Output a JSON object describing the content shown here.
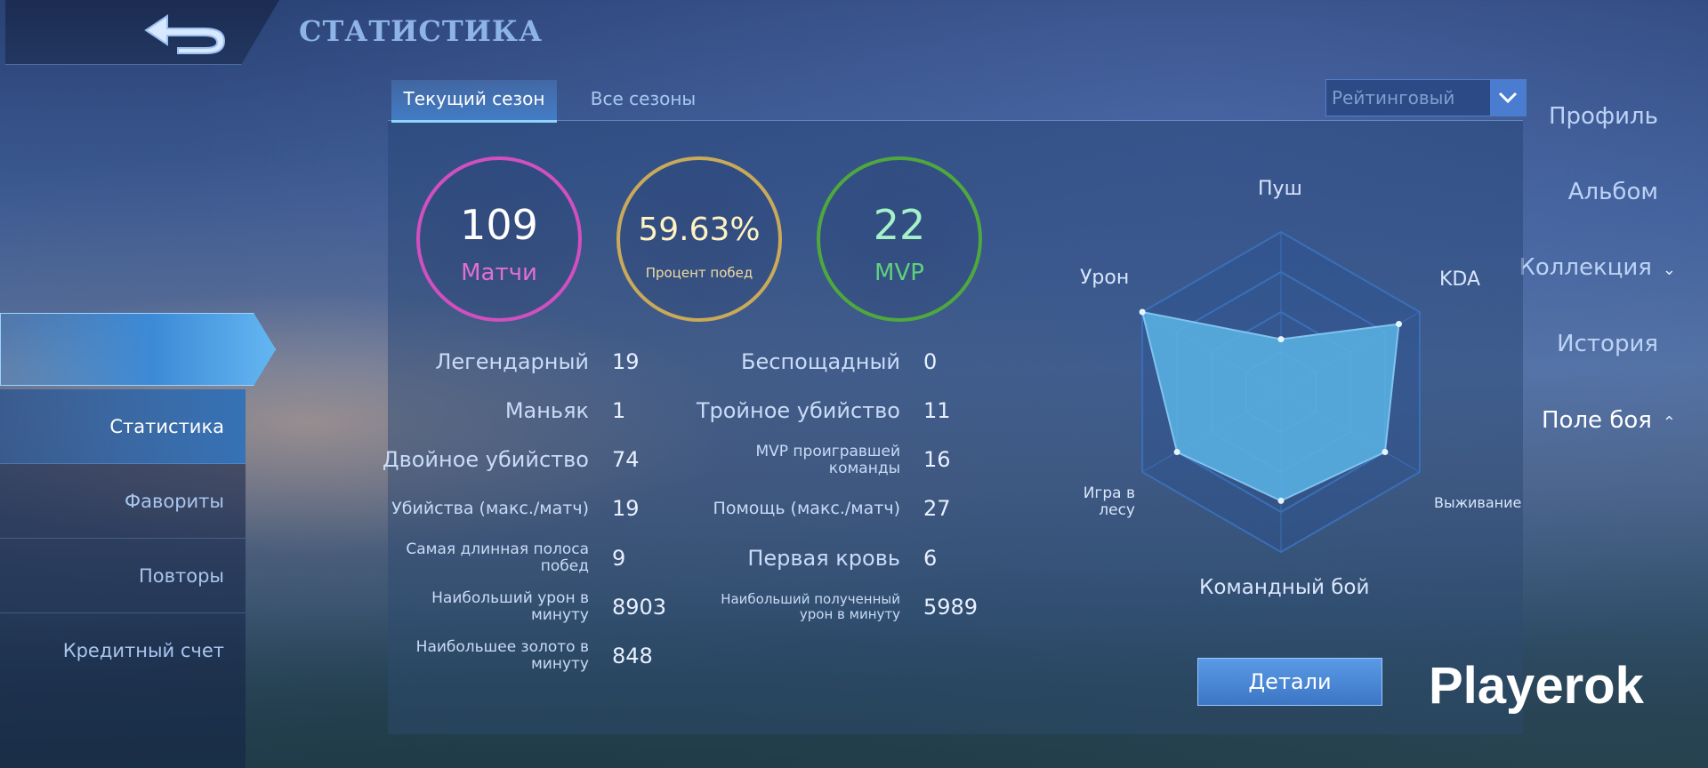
{
  "header": {
    "title": "СТАТИСТИКА"
  },
  "sidebar": {
    "items": [
      {
        "label": "Профиль"
      },
      {
        "label": "Альбом"
      },
      {
        "label": "Коллекция",
        "chevron": "⌄"
      },
      {
        "label": "История"
      },
      {
        "label": "Поле боя",
        "chevron": "⌃"
      }
    ],
    "subitems": [
      {
        "label": "Статистика"
      },
      {
        "label": "Фавориты"
      },
      {
        "label": "Повторы"
      },
      {
        "label": "Кредитный счет"
      }
    ]
  },
  "tabs": [
    {
      "label": "Текущий сезон"
    },
    {
      "label": "Все сезоны"
    }
  ],
  "mode_select": {
    "value": "Рейтинговый"
  },
  "summary": {
    "matches": {
      "value": "109",
      "label": "Матчи",
      "color": "#d14fbf"
    },
    "winrate": {
      "value": "59.63%",
      "label": "Процент побед",
      "color": "#c9a95a"
    },
    "mvp": {
      "value": "22",
      "label": "MVP",
      "color": "#4fa83d"
    }
  },
  "stats": {
    "left": [
      {
        "label": "Легендарный",
        "value": "19"
      },
      {
        "label": "Маньяк",
        "value": "1"
      },
      {
        "label": "Двойное убийство",
        "value": "74"
      },
      {
        "label": "Убийства (макс./матч)",
        "value": "19"
      },
      {
        "label_lines": [
          "Самая длинная полоса",
          "побед"
        ],
        "value": "9"
      },
      {
        "label_lines": [
          "Наибольший урон в",
          "минуту"
        ],
        "value": "8903"
      },
      {
        "label_lines": [
          "Наибольшее золото в",
          "минуту"
        ],
        "value": "848"
      }
    ],
    "right": [
      {
        "label": "Беспощадный",
        "value": "0"
      },
      {
        "label": "Тройное убийство",
        "value": "11"
      },
      {
        "label_lines": [
          "MVP проигравшей",
          "команды"
        ],
        "value": "16"
      },
      {
        "label": "Помощь (макс./матч)",
        "value": "27"
      },
      {
        "label": "Первая кровь",
        "value": "6"
      },
      {
        "label_lines": [
          "Наибольший полученный",
          "урон в минуту"
        ],
        "value": "5989"
      }
    ]
  },
  "radar": {
    "labels": {
      "push": "Пуш",
      "kda": "KDA",
      "survival": "Выживание",
      "teamfight": "Командный бой",
      "jungle": [
        "Игра в",
        "лесу"
      ],
      "damage": "Урон"
    },
    "values": {
      "push": 0.33,
      "kda": 0.85,
      "survival": 0.75,
      "teamfight": 0.68,
      "jungle": 0.75,
      "damage": 1.0
    }
  },
  "details_button": {
    "label": "Детали"
  },
  "watermark": {
    "text": "Playerok"
  }
}
